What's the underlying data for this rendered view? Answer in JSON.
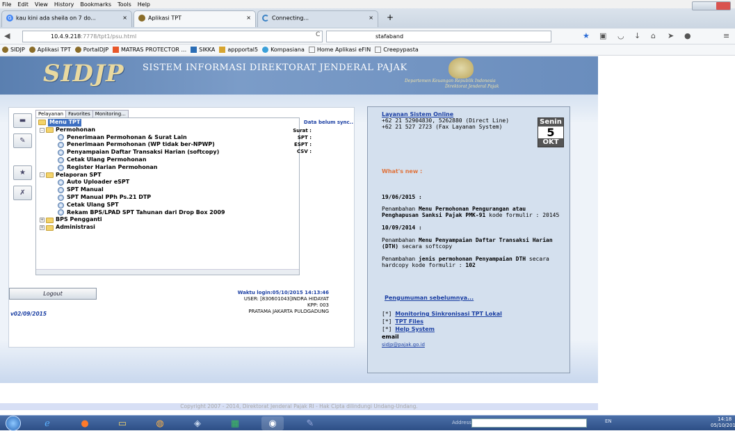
{
  "menubar": [
    "File",
    "Edit",
    "View",
    "History",
    "Bookmarks",
    "Tools",
    "Help"
  ],
  "tabs": [
    {
      "label": "kau kini ada sheila on 7 do...",
      "close": "×"
    },
    {
      "label": "Aplikasi TPT",
      "close": "×"
    },
    {
      "label": "Connecting...",
      "close": "×"
    }
  ],
  "new_tab": "+",
  "nav": {
    "url_host": "10.4.9.218",
    "url_path": ":7778/tpt1/psu.html",
    "search_value": "stafaband"
  },
  "bookmarks": [
    "SIDJP",
    "Aplikasi TPT",
    "PortalDJP",
    "MATRAS PROTECTOR ...",
    "SIKKA",
    "appportal5",
    "Kompasiana",
    "Home Aplikasi eFIN",
    "Creepypasta"
  ],
  "banner": {
    "logo": "SIDJP",
    "title": "SISTEM INFORMASI DIREKTORAT JENDERAL PAJAK",
    "sub1": "Departemen Keuangan Republik Indonesia",
    "sub2": "Direktorat Jenderal Pajak"
  },
  "panel_tabs": [
    "Pelayanan",
    "Favorites",
    "Monitoring..."
  ],
  "tree": [
    {
      "label": "Menu TPT",
      "level": 0,
      "type": "folder",
      "selected": true
    },
    {
      "label": "Permohonan",
      "level": 1,
      "type": "folder",
      "toggle": "-"
    },
    {
      "label": "Penerimaan Permohonan & Surat Lain",
      "level": 2,
      "type": "item"
    },
    {
      "label": "Penerimaan Permohonan (WP tidak ber-NPWP)",
      "level": 2,
      "type": "item"
    },
    {
      "label": "Penyampaian Daftar Transaksi Harian (softcopy)",
      "level": 2,
      "type": "item"
    },
    {
      "label": "Cetak Ulang Permohonan",
      "level": 2,
      "type": "item"
    },
    {
      "label": "Register Harian Permohonan",
      "level": 2,
      "type": "item"
    },
    {
      "label": "Pelaporan SPT",
      "level": 1,
      "type": "folder",
      "toggle": "-"
    },
    {
      "label": "Auto Uploader eSPT",
      "level": 2,
      "type": "item"
    },
    {
      "label": "SPT Manual",
      "level": 2,
      "type": "item"
    },
    {
      "label": "SPT Manual PPh Ps.21 DTP",
      "level": 2,
      "type": "item"
    },
    {
      "label": "Cetak Ulang SPT",
      "level": 2,
      "type": "item"
    },
    {
      "label": "Rekam BPS/LPAD SPT Tahunan dari Drop Box 2009",
      "level": 2,
      "type": "item"
    },
    {
      "label": "BPS Pengganti",
      "level": 1,
      "type": "folder",
      "toggle": "+"
    },
    {
      "label": "Administrasi",
      "level": 1,
      "type": "folder",
      "toggle": "+"
    }
  ],
  "sync": {
    "warning": "Data belum sync..",
    "surat": "Surat :",
    "spt": "SPT :",
    "espt": "ESPT :",
    "csv": "CSV :"
  },
  "logout_label": "Logout",
  "login": {
    "waktu": "Waktu login:05/10/2015 14:13:46",
    "user": "USER: [830601043]INDRA HIDAYAT",
    "kpp": "KPP: 003",
    "office": "PRATAMA JAKARTA PULOGADUNG"
  },
  "version": "v02/09/2015",
  "right": {
    "layanan": "Layanan Sistem Online",
    "phone1": "+62 21 52904830, 5262880 (Direct Line)",
    "phone2": "+62 21 527 2723 (Fax Layanan System)",
    "whatsnew": "What's new :",
    "date1": "19/06/2015 :",
    "news1_pre": "Penambahan ",
    "news1_bold": "Menu Permohonan Pengurangan atau Penghapusan Sanksi Pajak PMK-91",
    "news1_post": " kode formulir : 20145",
    "date2": "10/09/2014 :",
    "news2_pre": "Penambahan ",
    "news2_bold": "Menu Penyampaian Daftar Transaksi Harian (DTH)",
    "news2_post": " secara softcopy",
    "news3_pre": "Penambahan ",
    "news3_bold": "jenis permohonan Penyampaian DTH",
    "news3_post": " secara hardcopy kode formulir : ",
    "news3_code": "102",
    "pengumuman": "Pengumuman sebelumnya...",
    "link1_pre": "[*] ",
    "link1": "Monitoring Sinkronisasi TPT Lokal",
    "link2_pre": "[*] ",
    "link2": "TPT Files",
    "link3_pre": "[*] ",
    "link3": "Help System",
    "email_label": "email",
    "email": "sidjp@pajak.go.id"
  },
  "calendar": {
    "day": "Senin",
    "date": "5",
    "month": "OKT"
  },
  "footer": "Copyright 2007 - 2014, Direktorat Jenderal Pajak RI - Hak Cipta dilindungi Undang-Undang.",
  "taskbar": {
    "address_label": "Address",
    "tray": "EN",
    "time": "14:18",
    "date": "05/10/2015"
  }
}
